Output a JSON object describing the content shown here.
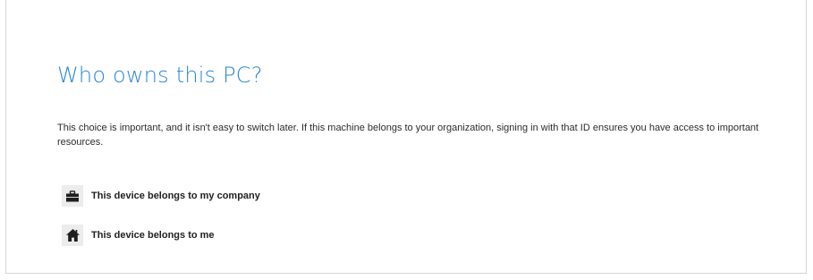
{
  "page": {
    "title": "Who owns this PC?",
    "description": "This choice is important, and it isn't easy to switch later. If this machine belongs to your organization, signing in with that ID ensures you have access to important resources."
  },
  "options": [
    {
      "label": "This device belongs to my company",
      "icon": "briefcase-icon"
    },
    {
      "label": "This device belongs to me",
      "icon": "home-icon"
    }
  ],
  "colors": {
    "title": "#2b88d8",
    "text": "#2c2c2c",
    "icon_background": "#ececec"
  }
}
